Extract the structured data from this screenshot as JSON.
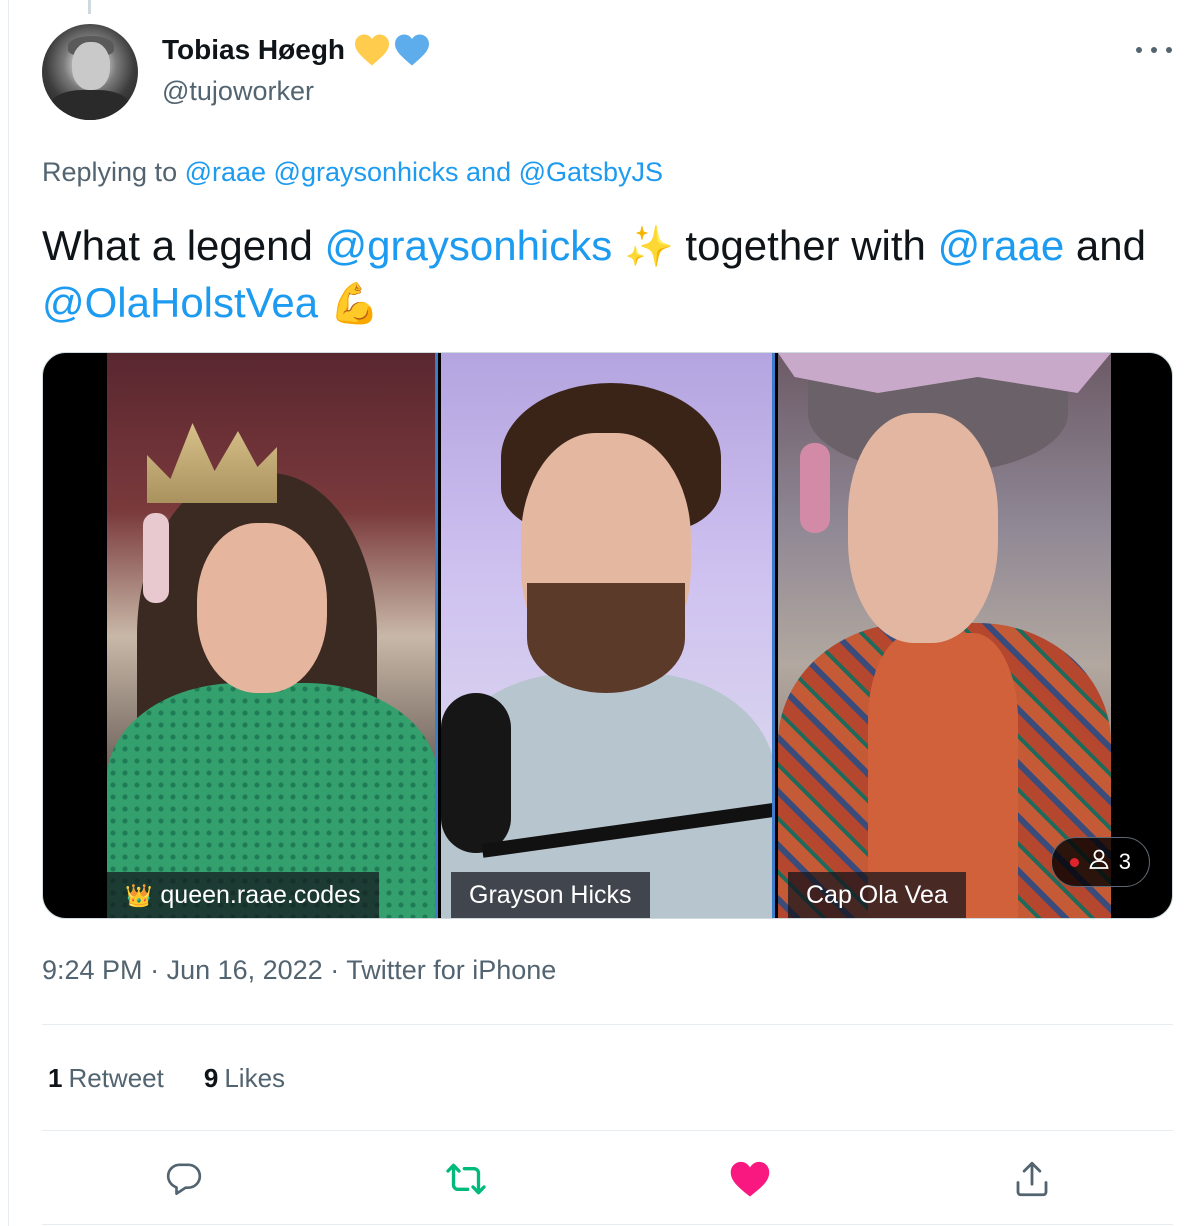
{
  "author": {
    "display_name": "Tobias Høegh",
    "handle": "@tujoworker",
    "badge_icons": [
      "yellow-heart-icon",
      "blue-heart-icon"
    ]
  },
  "reply": {
    "prefix": "Replying to",
    "mentions": "@raae @graysonhicks and @GatsbyJS"
  },
  "tweet": {
    "t1": "What a legend ",
    "m1": "@graysonhicks",
    "e1": "✨",
    "t2": " together with ",
    "m2": "@raae",
    "t3": " and ",
    "m3": "@OlaHolstVea",
    "e2": "💪"
  },
  "media": {
    "participants": [
      {
        "label": "queen.raae.codes",
        "icon": "👑"
      },
      {
        "label": "Grayson Hicks"
      },
      {
        "label": "Cap Ola Vea"
      }
    ],
    "viewer_count": "3"
  },
  "meta": {
    "time": "9:24 PM",
    "date": "Jun 16, 2022",
    "source": "Twitter for iPhone",
    "separator": " · "
  },
  "stats": {
    "retweets_count": "1",
    "retweets_label": "Retweet",
    "likes_count": "9",
    "likes_label": "Likes"
  },
  "actions": [
    "reply-icon",
    "retweet-icon",
    "like-icon",
    "share-icon"
  ],
  "colors": {
    "link": "#1d9bf0",
    "secondary_text": "#536471",
    "retweet": "#00ba7c",
    "like": "#f91880"
  }
}
